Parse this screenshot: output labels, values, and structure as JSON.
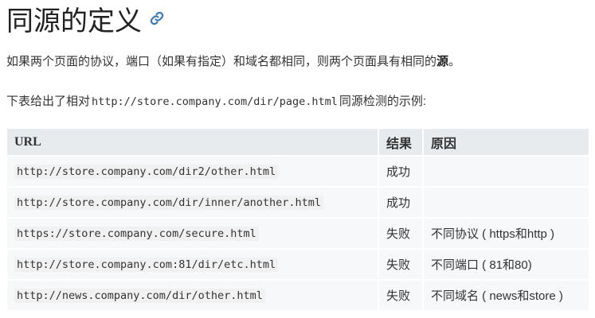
{
  "heading": {
    "title": "同源的定义",
    "anchor_icon": "link-icon"
  },
  "intro": {
    "text": "如果两个页面的协议，端口（如果有指定）和域名都相同，则两个页面具有相同的",
    "strong": "源",
    "end": "。"
  },
  "example_intro": {
    "before": "下表给出了相对",
    "code": "http://store.company.com/dir/page.html",
    "after": "同源检测的示例:"
  },
  "table": {
    "headers": [
      "URL",
      "结果",
      "原因"
    ],
    "rows": [
      {
        "url": "http://store.company.com/dir2/other.html",
        "result": "成功",
        "reason": ""
      },
      {
        "url": "http://store.company.com/dir/inner/another.html",
        "result": "成功",
        "reason": ""
      },
      {
        "url": "https://store.company.com/secure.html",
        "result": "失败",
        "reason": "不同协议 ( https和http )"
      },
      {
        "url": "http://store.company.com:81/dir/etc.html",
        "result": "失败",
        "reason": "不同端口 ( 81和80)"
      },
      {
        "url": "http://news.company.com/dir/other.html",
        "result": "失败",
        "reason": "不同域名 ( news和store )"
      }
    ]
  },
  "colors": {
    "link": "#3d7ab8",
    "header_bg": "#e8ebee",
    "cell_bg": "#f7f8f9"
  }
}
